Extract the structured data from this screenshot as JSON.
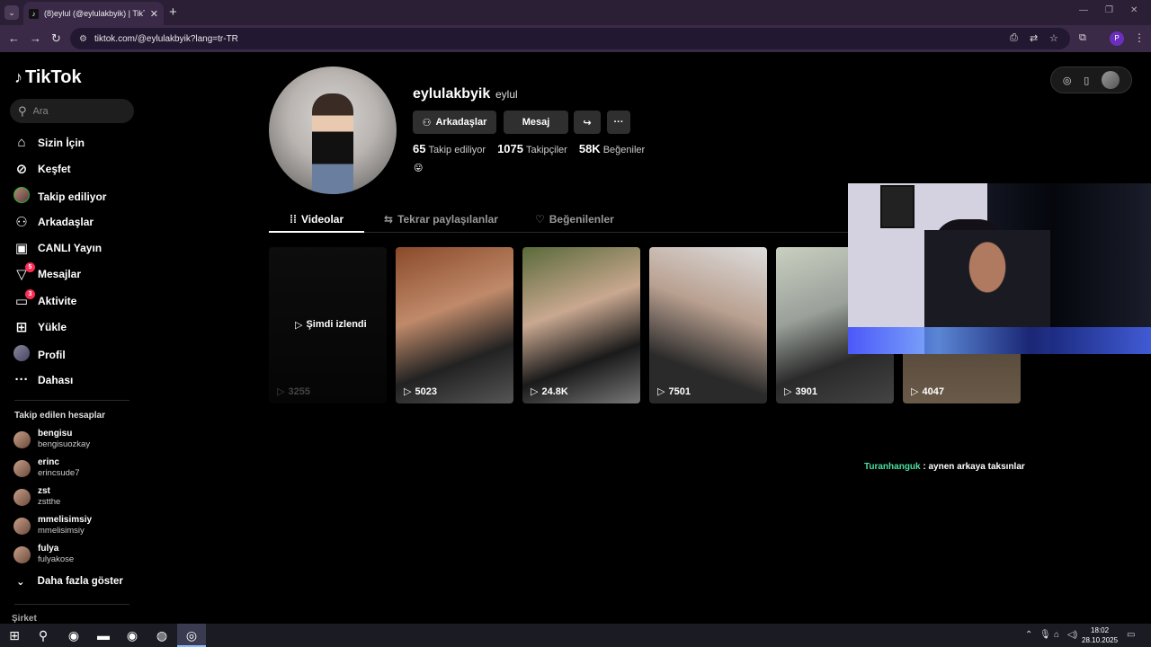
{
  "browser": {
    "tab_title": "(8)eylul (@eylulakbyik) | TikTok",
    "url": "tiktok.com/@eylulakbyik?lang=tr-TR"
  },
  "sidebar": {
    "logo": "TikTok",
    "search_placeholder": "Ara",
    "nav": [
      {
        "label": "Sizin İçin",
        "icon": "home-icon"
      },
      {
        "label": "Keşfet",
        "icon": "compass-icon"
      },
      {
        "label": "Takip ediliyor",
        "icon": "following-avatar"
      },
      {
        "label": "Arkadaşlar",
        "icon": "friends-icon"
      },
      {
        "label": "CANLI Yayın",
        "icon": "live-icon"
      },
      {
        "label": "Mesajlar",
        "icon": "send-icon",
        "badge": "5"
      },
      {
        "label": "Aktivite",
        "icon": "activity-icon",
        "badge": "3"
      },
      {
        "label": "Yükle",
        "icon": "upload-icon"
      },
      {
        "label": "Profil",
        "icon": "profile-avatar"
      },
      {
        "label": "Dahası",
        "icon": "more-icon"
      }
    ],
    "following_title": "Takip edilen hesaplar",
    "following": [
      {
        "name": "bengisu",
        "handle": "bengisuozkay"
      },
      {
        "name": "erinc",
        "handle": "erincsude7"
      },
      {
        "name": "zst",
        "handle": "zstthe"
      },
      {
        "name": "mmelisimsiy",
        "handle": "mmelisimsiy"
      },
      {
        "name": "fulya",
        "handle": "fulyakose"
      }
    ],
    "show_more": "Daha fazla göster",
    "company": "Şirket"
  },
  "profile": {
    "username": "eylulakbyik",
    "nickname": "eylul",
    "friends_btn": "Arkadaşlar",
    "message_btn": "Mesaj",
    "following_count": "65",
    "following_label": "Takip ediliyor",
    "followers_count": "1075",
    "followers_label": "Takipçiler",
    "likes_count": "58K",
    "likes_label": "Beğeniler",
    "bio_emoji": "😛"
  },
  "tabs": {
    "videos": "Videolar",
    "reposts": "Tekrar paylaşılanlar",
    "liked": "Beğenilenler"
  },
  "videos": [
    {
      "views": "3255",
      "watched_label": "Şimdi izlendi"
    },
    {
      "views": "5023"
    },
    {
      "views": "24.8K"
    },
    {
      "views": "7501"
    },
    {
      "views": "3901"
    },
    {
      "views": "4047"
    }
  ],
  "chat": {
    "user": "Turanhanguk",
    "message": ": aynen arkaya taksınlar"
  },
  "taskbar": {
    "time": "18:02",
    "date": "28.10.2025"
  },
  "colors": {
    "accent": "#fe2c55",
    "chat_user": "#4be0a0",
    "browser_frame": "#3a2a48"
  }
}
